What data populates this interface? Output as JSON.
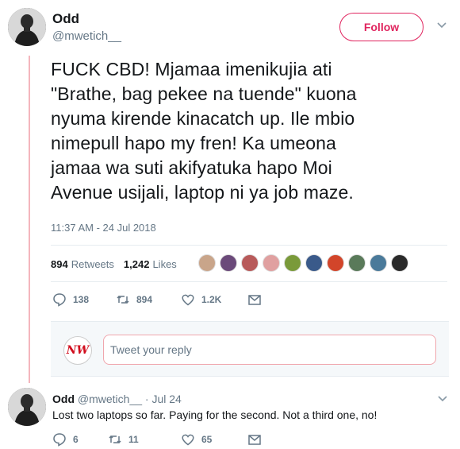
{
  "tweet": {
    "display_name": "Odd",
    "handle": "@mwetich__",
    "follow_label": "Follow",
    "text_lines": [
      "FUCK CBD! Mjamaa imenikujia ati",
      "\"Brathe, bag pekee na tuende\" kuona",
      "nyuma kirende kinacatch up. Ile mbio",
      "nimepull hapo my fren! Ka umeona",
      "jamaa wa suti akifyatuka hapo Moi",
      "Avenue usijali, laptop ni ya job maze."
    ],
    "timestamp": "11:37 AM - 24 Jul 2018",
    "retweets_count": "894",
    "retweets_label": "Retweets",
    "likes_count": "1,242",
    "likes_label": "Likes",
    "actions": {
      "replies": "138",
      "retweets": "894",
      "likes": "1.2K"
    },
    "liker_colors": [
      "#c9a58a",
      "#6b4a7a",
      "#b85a5a",
      "#e0a0a0",
      "#7a9a3a",
      "#3a5a8a",
      "#d2452a",
      "#5a7a5a",
      "#4a7a9a",
      "#2a2a2a"
    ]
  },
  "reply_box": {
    "logo_text": "NW",
    "placeholder": "Tweet your reply"
  },
  "reply": {
    "display_name": "Odd",
    "handle": "@mwetich__",
    "date": "· Jul 24",
    "text": "Lost two laptops so far. Paying for the second. Not a third one, no!",
    "actions": {
      "replies": "6",
      "retweets": "11",
      "likes": "65"
    }
  },
  "colors": {
    "accent": "#e0245e",
    "thread_line": "#f4b6bd",
    "secondary_text": "#657786"
  }
}
